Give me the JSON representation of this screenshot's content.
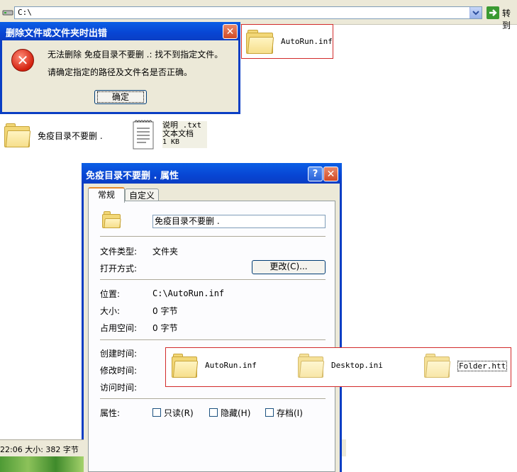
{
  "address_bar": {
    "path": "C:\\",
    "go_label": "转到"
  },
  "desktop_items": {
    "autorun_top": {
      "name": "AutoRun.inf"
    },
    "folder_main": {
      "name": "免疫目录不要删 ."
    },
    "txt_file": {
      "name": "说明 .txt",
      "type": "文本文档",
      "size": "1 KB"
    }
  },
  "error_dialog": {
    "title": "删除文件或文件夹时出错",
    "message1": "无法删除 免疫目录不要删 .: 找不到指定文件。",
    "message2": "请确定指定的路径及文件名是否正确。",
    "ok_label": "确定",
    "close_glyph": "✕",
    "error_glyph": "✕"
  },
  "properties_dialog": {
    "title": "免疫目录不要删 . 属性",
    "help_glyph": "?",
    "close_glyph": "✕",
    "tabs": [
      "常规",
      "自定义"
    ],
    "name_value": "免疫目录不要删 .",
    "rows": {
      "type_label": "文件类型:",
      "type_value": "文件夹",
      "open_label": "打开方式:",
      "change_label": "更改(C)...",
      "location_label": "位置:",
      "location_value": "C:\\AutoRun.inf",
      "size_label": "大小:",
      "size_value": "0 字节",
      "disk_label": "占用空间:",
      "disk_value": "0 字节",
      "created_label": "创建时间:",
      "modified_label": "修改时间:",
      "accessed_label": "访问时间:",
      "attr_label": "属性:",
      "readonly_label": "只读(R)",
      "hidden_label": "隐藏(H)",
      "archive_label": "存档(I)"
    }
  },
  "highlight_files": [
    {
      "name": "AutoRun.inf"
    },
    {
      "name": "Desktop.ini"
    },
    {
      "name": "Folder.htt"
    }
  ],
  "status_bar": {
    "text": "22:06 大小: 382 字节"
  },
  "colors": {
    "title_blue": "#0a3ec4",
    "highlight_red": "#d22b2b",
    "folder_yellow": "#f2d777"
  }
}
